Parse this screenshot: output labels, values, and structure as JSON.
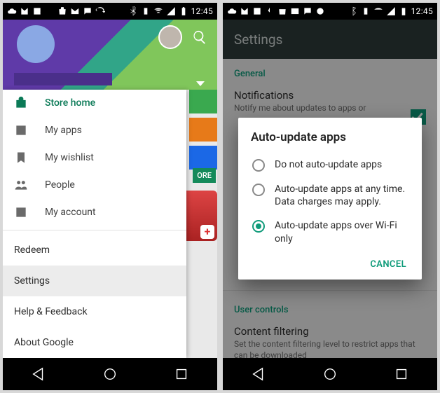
{
  "status": {
    "time": "12:45"
  },
  "left": {
    "drawer": {
      "items": [
        {
          "label": "Store home"
        },
        {
          "label": "My apps"
        },
        {
          "label": "My wishlist"
        },
        {
          "label": "People"
        },
        {
          "label": "My account"
        }
      ],
      "plain": [
        {
          "label": "Redeem"
        },
        {
          "label": "Settings"
        },
        {
          "label": "Help & Feedback"
        },
        {
          "label": "About Google"
        }
      ]
    },
    "more_chip": "ORE",
    "plus": "+"
  },
  "right": {
    "appbar_title": "Settings",
    "section_general": "General",
    "notif": {
      "title": "Notifications",
      "sub": "Notify me about updates to apps or"
    },
    "dialog": {
      "title": "Auto-update apps",
      "options": [
        "Do not auto-update apps",
        "Auto-update apps at any time. Data charges may apply.",
        "Auto-update apps over Wi-Fi only"
      ],
      "cancel": "CANCEL"
    },
    "section_user": "User controls",
    "filter": {
      "title": "Content filtering",
      "sub": "Set the content filtering level to restrict apps that can be downloaded"
    }
  }
}
